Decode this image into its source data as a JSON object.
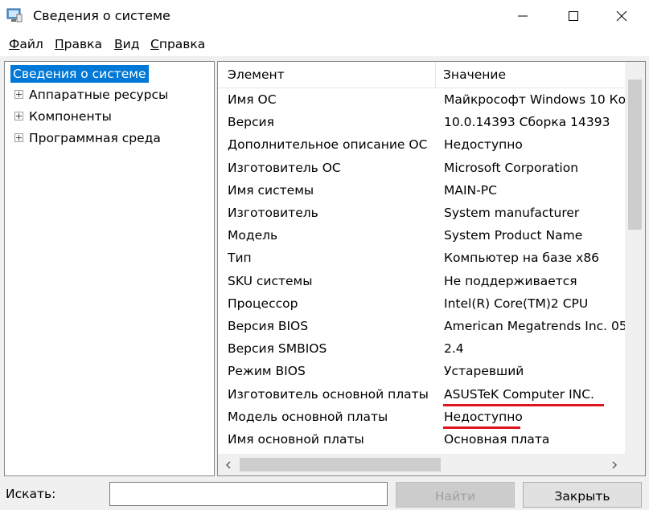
{
  "window": {
    "title": "Сведения о системе",
    "controls": [
      "minimize-icon",
      "maximize-icon",
      "close-icon"
    ]
  },
  "menu": [
    {
      "hotkey": "Ф",
      "rest": "айл"
    },
    {
      "hotkey": "П",
      "rest": "равка"
    },
    {
      "hotkey": "В",
      "rest": "ид"
    },
    {
      "hotkey": "С",
      "rest": "правка"
    }
  ],
  "tree": {
    "root": "Сведения о системе",
    "children": [
      "Аппаратные ресурсы",
      "Компоненты",
      "Программная среда"
    ]
  },
  "table": {
    "headers": {
      "element": "Элемент",
      "value": "Значение"
    },
    "rows": [
      {
        "name": "Имя ОС",
        "value": "Майкрософт Windows 10 Ко"
      },
      {
        "name": "Версия",
        "value": "10.0.14393 Сборка 14393"
      },
      {
        "name": "Дополнительное описание ОС",
        "value": "Недоступно"
      },
      {
        "name": "Изготовитель ОС",
        "value": "Microsoft Corporation"
      },
      {
        "name": "Имя системы",
        "value": "MAIN-PC"
      },
      {
        "name": "Изготовитель",
        "value": "System manufacturer"
      },
      {
        "name": "Модель",
        "value": "System Product Name"
      },
      {
        "name": "Тип",
        "value": "Компьютер на базе x86"
      },
      {
        "name": "SKU системы",
        "value": "Не поддерживается"
      },
      {
        "name": "Процессор",
        "value": "Intel(R) Core(TM)2 CPU"
      },
      {
        "name": "Версия BIOS",
        "value": "American Megatrends Inc. 05"
      },
      {
        "name": "Версия SMBIOS",
        "value": "2.4"
      },
      {
        "name": "Режим BIOS",
        "value": "Устаревший"
      },
      {
        "name": "Изготовитель основной платы",
        "value": "ASUSTeK Computer INC."
      },
      {
        "name": "Модель основной платы",
        "value": "Недоступно"
      },
      {
        "name": "Имя основной платы",
        "value": "Основная плата"
      }
    ]
  },
  "search": {
    "label": "Искать:",
    "value": ""
  },
  "buttons": {
    "find": "Найти",
    "close": "Закрыть"
  },
  "colors": {
    "selection": "#0078d7",
    "highlight_underline": "#e0141e"
  }
}
